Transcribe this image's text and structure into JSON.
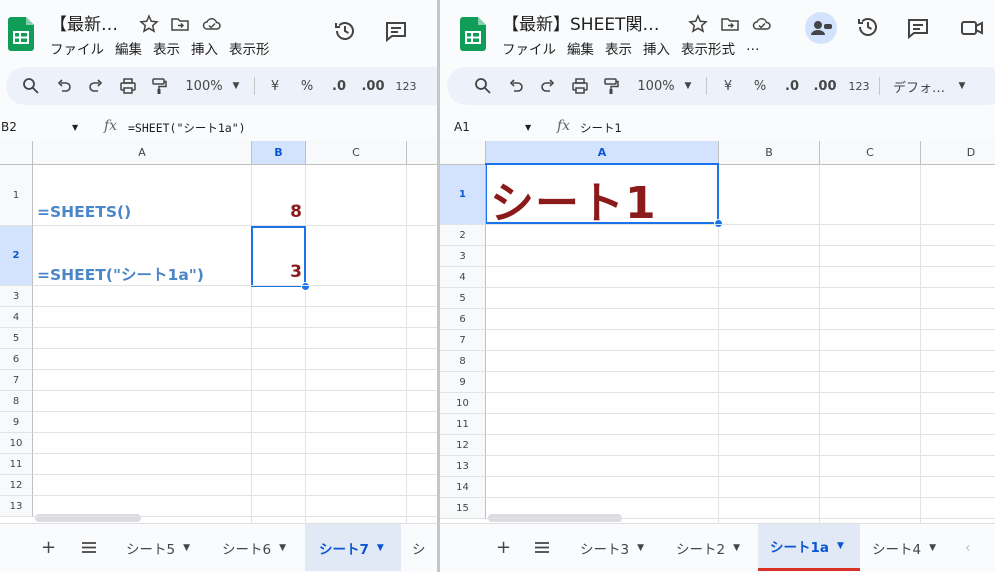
{
  "left": {
    "title": "【最新…",
    "menu": [
      "ファイル",
      "編集",
      "表示",
      "挿入",
      "表示形"
    ],
    "toolbar": {
      "zoom": "100%",
      "currency": "¥",
      "percent": "%",
      "dec_dec": ".0",
      "inc_dec": ".00",
      "format": "123"
    },
    "name_box": "B2",
    "formula": "=SHEET(\"シート1a\")",
    "columns": [
      "A",
      "B",
      "C"
    ],
    "rows": [
      "1",
      "2",
      "3",
      "4",
      "5",
      "6",
      "7",
      "8",
      "9",
      "10",
      "11",
      "12",
      "13"
    ],
    "cells": {
      "A1": "=SHEETS()",
      "B1": "8",
      "A2": "=SHEET(\"シート1a\")",
      "B2": "3"
    },
    "tabs": [
      "シート5",
      "シート6",
      "シート7",
      "シ"
    ],
    "active_tab": "シート7"
  },
  "right": {
    "title": "【最新】SHEET関…",
    "menu": [
      "ファイル",
      "編集",
      "表示",
      "挿入",
      "表示形式",
      "…"
    ],
    "toolbar": {
      "zoom": "100%",
      "currency": "¥",
      "percent": "%",
      "dec_dec": ".0",
      "inc_dec": ".00",
      "format": "123",
      "font": "デフォ…"
    },
    "name_box": "A1",
    "formula": "シート1",
    "columns": [
      "A",
      "B",
      "C",
      "D"
    ],
    "rows": [
      "1",
      "2",
      "3",
      "4",
      "5",
      "6",
      "7",
      "8",
      "9",
      "10",
      "11",
      "12",
      "13",
      "14",
      "15"
    ],
    "cells": {
      "A1": "シート1"
    },
    "tabs": [
      "シート3",
      "シート2",
      "シート1a",
      "シート4"
    ],
    "active_tab": "シート1a"
  },
  "colors": {
    "formula_text": "#4a86c8",
    "value_text": "#8b1a1a",
    "selection": "#1a73e8",
    "active_tab_underline": "#d93025"
  },
  "icons": [
    "sheets-logo",
    "star-icon",
    "move-folder-icon",
    "cloud-saved-icon",
    "history-icon",
    "comment-icon",
    "meet-icon",
    "share-avatar-icon",
    "search-icon",
    "undo-icon",
    "redo-icon",
    "print-icon",
    "paint-format-icon",
    "dropdown-icon",
    "add-sheet-icon",
    "all-sheets-icon",
    "scroll-left-icon"
  ]
}
